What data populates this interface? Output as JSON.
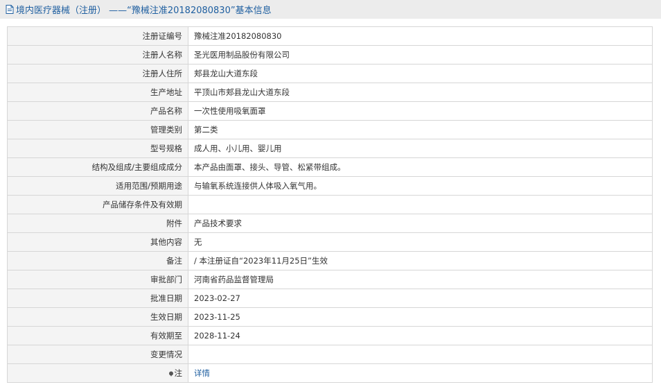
{
  "header": {
    "title": "境内医疗器械（注册） ——“豫械注准20182080830”基本信息"
  },
  "rows": [
    {
      "label": "注册证编号",
      "value": "豫械注准20182080830"
    },
    {
      "label": "注册人名称",
      "value": "圣光医用制品股份有限公司"
    },
    {
      "label": "注册人住所",
      "value": "郏县龙山大道东段"
    },
    {
      "label": "生产地址",
      "value": "平顶山市郏县龙山大道东段"
    },
    {
      "label": "产品名称",
      "value": "一次性使用吸氧面罩"
    },
    {
      "label": "管理类别",
      "value": "第二类"
    },
    {
      "label": "型号规格",
      "value": "成人用、小儿用、婴儿用"
    },
    {
      "label": "结构及组成/主要组成成分",
      "value": "本产品由面罩、接头、导管、松紧带组成。"
    },
    {
      "label": "适用范围/预期用途",
      "value": "与输氧系统连接供人体吸入氧气用。"
    },
    {
      "label": "产品储存条件及有效期",
      "value": ""
    },
    {
      "label": "附件",
      "value": "产品技术要求"
    },
    {
      "label": "其他内容",
      "value": "无"
    },
    {
      "label": "备注",
      "value": "/ 本注册证自“2023年11月25日”生效"
    },
    {
      "label": "审批部门",
      "value": "河南省药品监督管理局"
    },
    {
      "label": "批准日期",
      "value": "2023-02-27"
    },
    {
      "label": "生效日期",
      "value": "2023-11-25"
    },
    {
      "label": "有效期至",
      "value": "2028-11-24"
    },
    {
      "label": "变更情况",
      "value": ""
    }
  ],
  "note": {
    "label": "注",
    "link": "详情"
  },
  "colors": {
    "title_text": "#1f5fa0",
    "title_bg": "#ececec",
    "label_bg": "#f4f4f4",
    "border": "#d6d6d6",
    "link": "#1f5fa0"
  }
}
